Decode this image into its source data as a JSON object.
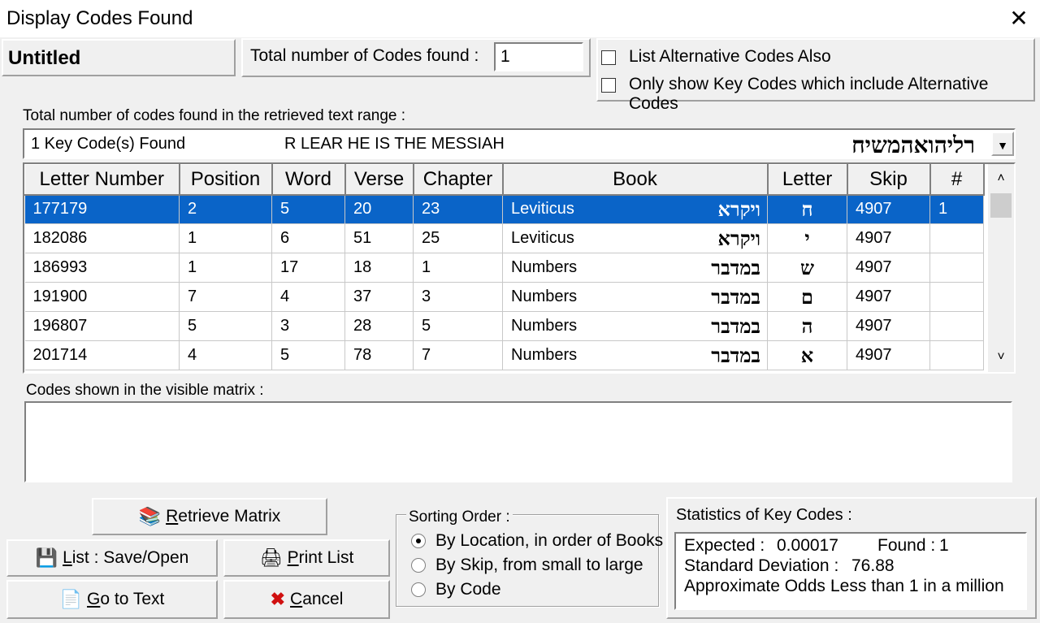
{
  "window": {
    "title": "Display Codes Found",
    "close_glyph": "✕"
  },
  "header": {
    "name": "Untitled",
    "total_label": "Total number of Codes found :",
    "total_value": "1",
    "checkboxes": [
      {
        "label": "List Alternative Codes Also",
        "checked": false
      },
      {
        "label": "Only show Key Codes which include Alternative Codes",
        "checked": false
      }
    ]
  },
  "range": {
    "label": "Total number of codes found in the retrieved text range  :",
    "combo_count": "1 Key Code(s) Found",
    "combo_text": "R LEAR HE IS THE MESSIAH",
    "combo_hebrew": "רליהואהמשיח"
  },
  "grid": {
    "columns": [
      "Letter Number",
      "Position",
      "Word",
      "Verse",
      "Chapter",
      "Book",
      "Letter",
      "Skip",
      "#"
    ],
    "rows": [
      {
        "letter_number": "177179",
        "position": "2",
        "word": "5",
        "verse": "20",
        "chapter": "23",
        "book": "Leviticus",
        "book_hebrew": "ויקרא",
        "letter": "ח",
        "skip": "4907",
        "num": "1",
        "selected": true
      },
      {
        "letter_number": "182086",
        "position": "1",
        "word": "6",
        "verse": "51",
        "chapter": "25",
        "book": "Leviticus",
        "book_hebrew": "ויקרא",
        "letter": "י",
        "skip": "4907",
        "num": "",
        "selected": false
      },
      {
        "letter_number": "186993",
        "position": "1",
        "word": "17",
        "verse": "18",
        "chapter": "1",
        "book": "Numbers",
        "book_hebrew": "במדבר",
        "letter": "ש",
        "skip": "4907",
        "num": "",
        "selected": false
      },
      {
        "letter_number": "191900",
        "position": "7",
        "word": "4",
        "verse": "37",
        "chapter": "3",
        "book": "Numbers",
        "book_hebrew": "במדבר",
        "letter": "ם",
        "skip": "4907",
        "num": "",
        "selected": false
      },
      {
        "letter_number": "196807",
        "position": "5",
        "word": "3",
        "verse": "28",
        "chapter": "5",
        "book": "Numbers",
        "book_hebrew": "במדבר",
        "letter": "ה",
        "skip": "4907",
        "num": "",
        "selected": false
      },
      {
        "letter_number": "201714",
        "position": "4",
        "word": "5",
        "verse": "78",
        "chapter": "7",
        "book": "Numbers",
        "book_hebrew": "במדבר",
        "letter": "א",
        "skip": "4907",
        "num": "",
        "selected": false
      }
    ],
    "selection_color": "#0a64c8"
  },
  "matrix": {
    "label": "Codes shown in the visible matrix :"
  },
  "buttons": {
    "retrieve": {
      "hotkey": "R",
      "rest": "etrieve Matrix",
      "icon": "books-icon"
    },
    "list": {
      "hotkey": "L",
      "rest": "ist : Save/Open",
      "icon": "disk-icon"
    },
    "print": {
      "hotkey": "P",
      "rest": "rint List",
      "icon": "printer-icon"
    },
    "goto": {
      "hotkey": "G",
      "rest": "o to Text",
      "icon": "document-icon"
    },
    "cancel": {
      "hotkey": "C",
      "rest": "ancel",
      "icon": "x-icon"
    }
  },
  "sorting": {
    "title": "Sorting Order :",
    "options": [
      {
        "label": "By Location, in order of Books",
        "selected": true
      },
      {
        "label": "By Skip, from small to large",
        "selected": false
      },
      {
        "label": "By Code",
        "selected": false
      }
    ]
  },
  "stats": {
    "title": "Statistics of Key Codes :",
    "expected_label": "Expected :",
    "expected_value": "0.00017",
    "found_label": "Found :",
    "found_value": "1",
    "stddev_label": "Standard Deviation :",
    "stddev_value": "76.88",
    "odds_label": "Approximate Odds :",
    "odds_value": "Less than 1 in a million"
  }
}
